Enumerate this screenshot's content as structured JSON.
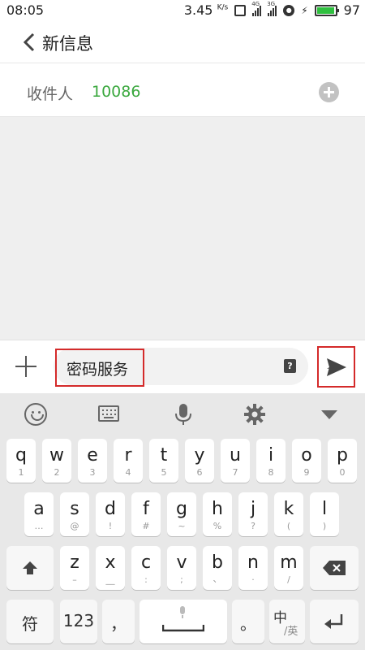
{
  "status_bar": {
    "time": "08:05",
    "speed": "3.45",
    "speed_unit": "K/s",
    "net1": "4G",
    "net2": "3G",
    "battery": "97"
  },
  "header": {
    "title": "新信息"
  },
  "recipient": {
    "label": "收件人",
    "number": "10086"
  },
  "compose": {
    "text": "密码服务",
    "help": "?"
  },
  "keyboard": {
    "row1": [
      {
        "k": "q",
        "s": "1"
      },
      {
        "k": "w",
        "s": "2"
      },
      {
        "k": "e",
        "s": "3"
      },
      {
        "k": "r",
        "s": "4"
      },
      {
        "k": "t",
        "s": "5"
      },
      {
        "k": "y",
        "s": "6"
      },
      {
        "k": "u",
        "s": "7"
      },
      {
        "k": "i",
        "s": "8"
      },
      {
        "k": "o",
        "s": "9"
      },
      {
        "k": "p",
        "s": "0"
      }
    ],
    "row2": [
      {
        "k": "a",
        "s": "…"
      },
      {
        "k": "s",
        "s": "@"
      },
      {
        "k": "d",
        "s": "!"
      },
      {
        "k": "f",
        "s": "#"
      },
      {
        "k": "g",
        "s": "~"
      },
      {
        "k": "h",
        "s": "%"
      },
      {
        "k": "j",
        "s": "?"
      },
      {
        "k": "k",
        "s": "("
      },
      {
        "k": "l",
        "s": ")"
      }
    ],
    "row3": [
      {
        "k": "z",
        "s": "–"
      },
      {
        "k": "x",
        "s": "__"
      },
      {
        "k": "c",
        "s": ":"
      },
      {
        "k": "v",
        "s": ";"
      },
      {
        "k": "b",
        "s": "、"
      },
      {
        "k": "n",
        "s": "·"
      },
      {
        "k": "m",
        "s": "/"
      }
    ],
    "symbols_label": "符",
    "numbers_label": "123",
    "comma_label": "，",
    "period_label": "。",
    "lang_main": "中",
    "lang_sub": "/英"
  },
  "colors": {
    "accent_green": "#3aa83e",
    "highlight_red": "#d42a2a"
  }
}
